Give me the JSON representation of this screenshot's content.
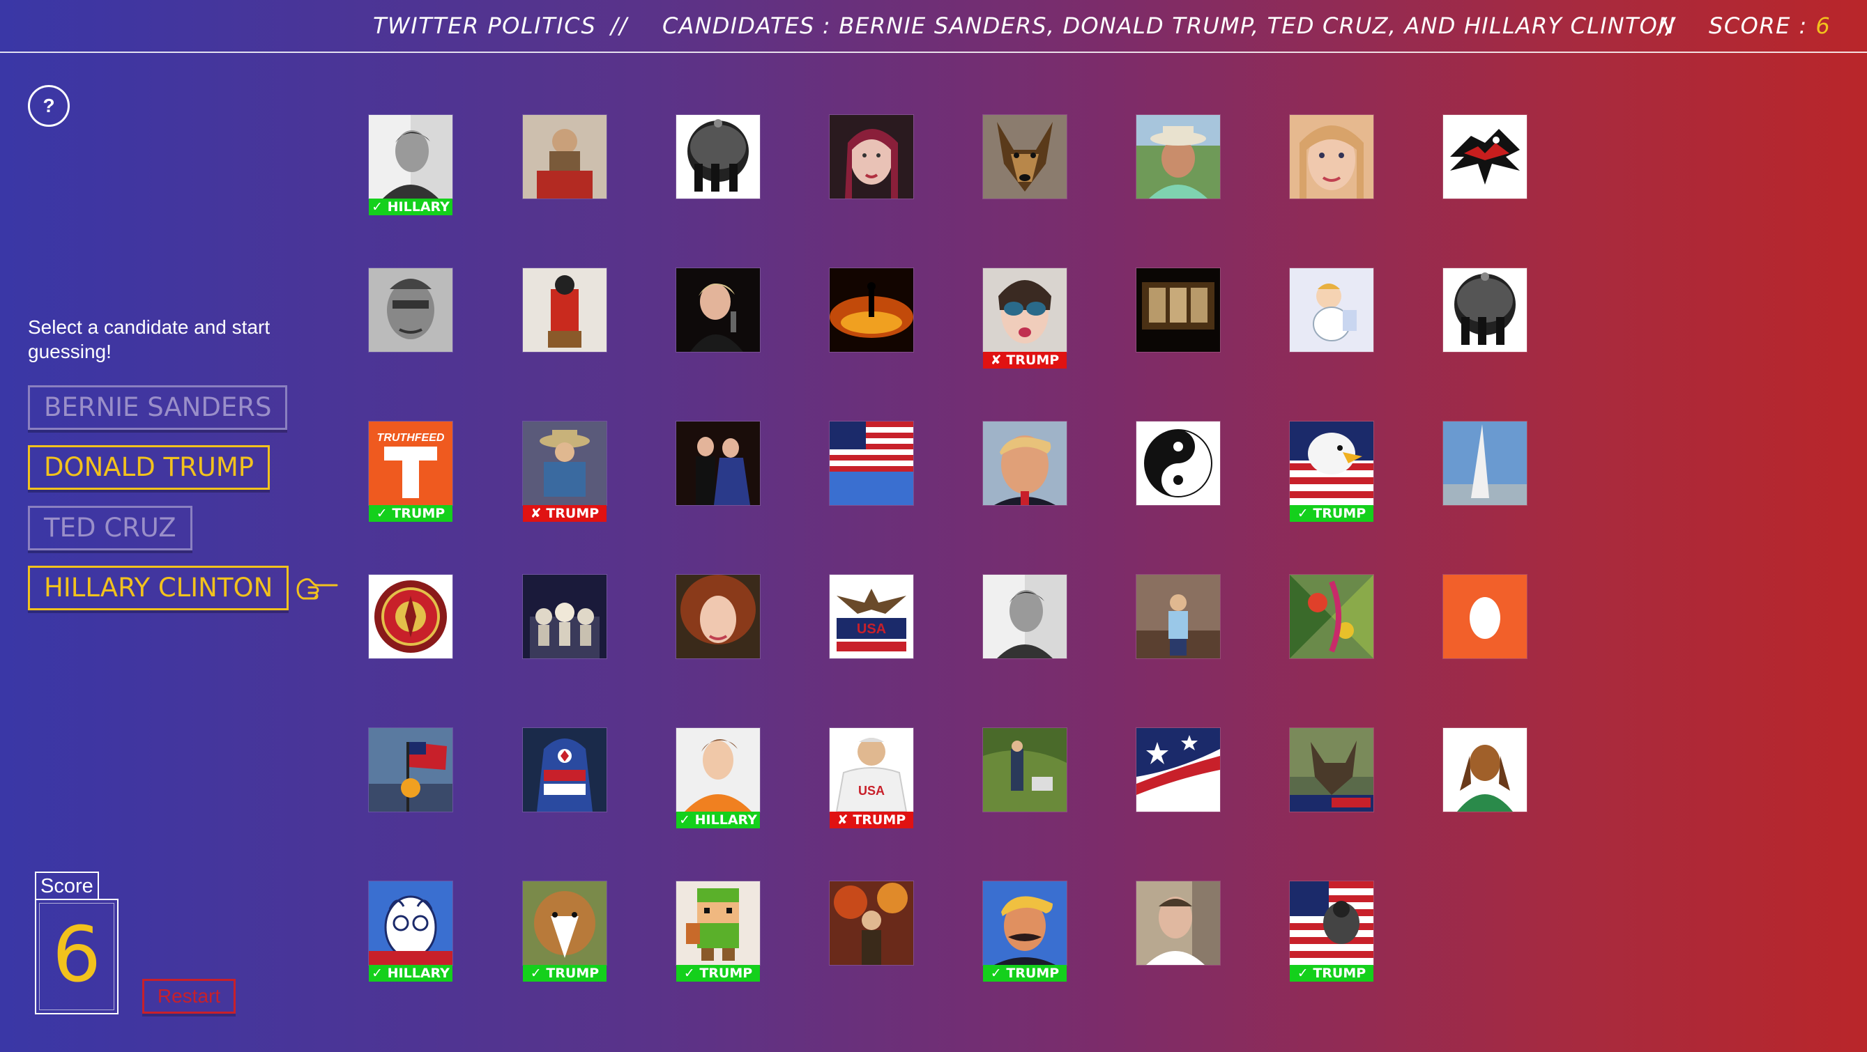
{
  "header": {
    "title": "TWITTER POLITICS",
    "sep": "//",
    "candidates_text": "CANDIDATES : BERNIE SANDERS, DONALD TRUMP, TED CRUZ, AND HILLARY CLINTON",
    "score_label": "SCORE : ",
    "score_value": "6"
  },
  "help_label": "?",
  "instructions": "Select a candidate and start guessing!",
  "candidates": [
    {
      "label": "BERNIE SANDERS",
      "state": "dim"
    },
    {
      "label": "DONALD TRUMP",
      "state": "active"
    },
    {
      "label": "TED CRUZ",
      "state": "dim"
    },
    {
      "label": "HILLARY CLINTON",
      "state": "active"
    }
  ],
  "pointer_icon": "pointing-hand-icon",
  "score": {
    "label": "Score",
    "value": "6"
  },
  "restart_label": "Restart",
  "colors": {
    "accent": "#f2c21d",
    "correct": "#14d01c",
    "wrong": "#e01212"
  },
  "grid": [
    {
      "img": "man-bw-portrait",
      "badge": "✓ HILLARY",
      "ok": true
    },
    {
      "img": "child-toy"
    },
    {
      "img": "band-circle"
    },
    {
      "img": "woman-red-hair"
    },
    {
      "img": "german-shepherd"
    },
    {
      "img": "man-hat"
    },
    {
      "img": "woman-blonde"
    },
    {
      "img": "native-eagle"
    },
    {
      "img": "man-bw-closeup"
    },
    {
      "img": "red-costume"
    },
    {
      "img": "hillary-speaking"
    },
    {
      "img": "fire-silhouette"
    },
    {
      "img": "woman-sunglasses",
      "badge": "✘ TRUMP",
      "ok": false
    },
    {
      "img": "dark-window"
    },
    {
      "img": "cartoon-baby"
    },
    {
      "img": "band-circle"
    },
    {
      "img": "truthfeed-t",
      "badge": "✓ TRUMP",
      "ok": true
    },
    {
      "img": "cowboy-toy",
      "badge": "✘ TRUMP",
      "ok": false
    },
    {
      "img": "couple-formal"
    },
    {
      "img": "us-flag"
    },
    {
      "img": "trump-face"
    },
    {
      "img": "yin-yang"
    },
    {
      "img": "eagle-flag",
      "badge": "✓ TRUMP",
      "ok": true
    },
    {
      "img": "monument-sky"
    },
    {
      "img": "marine-seal"
    },
    {
      "img": "toy-figures"
    },
    {
      "img": "woman-curly-hair"
    },
    {
      "img": "eagle-banner"
    },
    {
      "img": "man-bw-portrait"
    },
    {
      "img": "man-room"
    },
    {
      "img": "tropical-art"
    },
    {
      "img": "egg-avatar"
    },
    {
      "img": "flag-sunset"
    },
    {
      "img": "captain-america"
    },
    {
      "img": "young-man-orange",
      "badge": "✓ HILLARY",
      "ok": true
    },
    {
      "img": "man-usa-shirt",
      "badge": "✘ TRUMP",
      "ok": false
    },
    {
      "img": "person-grass"
    },
    {
      "img": "flag-stars"
    },
    {
      "img": "dog-collage"
    },
    {
      "img": "basset-hound"
    },
    {
      "img": "bernie-cartoon",
      "badge": "✓ HILLARY",
      "ok": true
    },
    {
      "img": "collie-dog",
      "badge": "✓ TRUMP",
      "ok": true
    },
    {
      "img": "pixel-link",
      "badge": "✓ TRUMP",
      "ok": true
    },
    {
      "img": "autumn-person"
    },
    {
      "img": "trump-cartoon",
      "badge": "✓ TRUMP",
      "ok": true
    },
    {
      "img": "man-selfie"
    },
    {
      "img": "flag-soldier",
      "badge": "✓ TRUMP",
      "ok": true
    }
  ]
}
